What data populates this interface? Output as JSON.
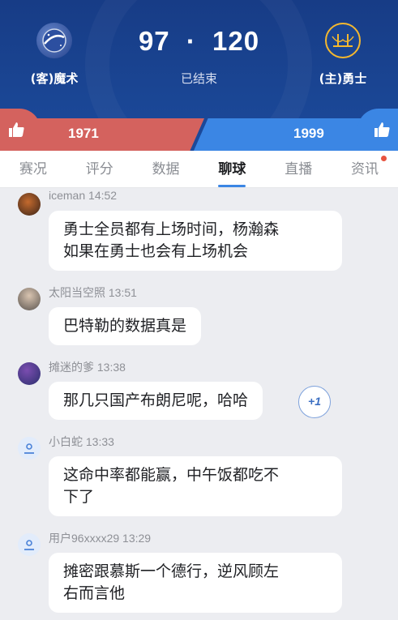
{
  "game": {
    "away_team": "(客)魔术",
    "home_team": "(主)勇士",
    "away_score": "97",
    "home_score": "120",
    "separator": "·",
    "status": "已结束"
  },
  "votes": {
    "away_count": "1971",
    "home_count": "1999"
  },
  "tabs": [
    {
      "label": "赛况"
    },
    {
      "label": "评分"
    },
    {
      "label": "数据"
    },
    {
      "label": "聊球"
    },
    {
      "label": "直播"
    },
    {
      "label": "资讯"
    }
  ],
  "active_tab": "聊球",
  "messages": [
    {
      "user": "iceman",
      "time": "14:52",
      "lines": [
        "勇士全员都有上场时间，杨瀚森",
        "如果在勇士也会有上场机会"
      ]
    },
    {
      "user": "太阳当空照",
      "time": "13:51",
      "lines": [
        "巴特勒的数据真是"
      ]
    },
    {
      "user": "摊迷的爹",
      "time": "13:38",
      "lines": [
        "那几只国产布朗尼呢，哈哈"
      ],
      "plus": "+1"
    },
    {
      "user": "小白蛇",
      "time": "13:33",
      "lines": [
        "这命中率都能赢，中午饭都吃不",
        "下了"
      ]
    },
    {
      "user": "用户96xxxx29",
      "time": "13:29",
      "lines": [
        "摊密跟慕斯一个德行，逆风顾左",
        "右而言他"
      ]
    }
  ],
  "colors": {
    "header_bg": "#1a4593",
    "away_vote": "#d4625e",
    "home_vote": "#3b86e4",
    "accent": "#3b86e4",
    "badge": "#e8533f"
  }
}
